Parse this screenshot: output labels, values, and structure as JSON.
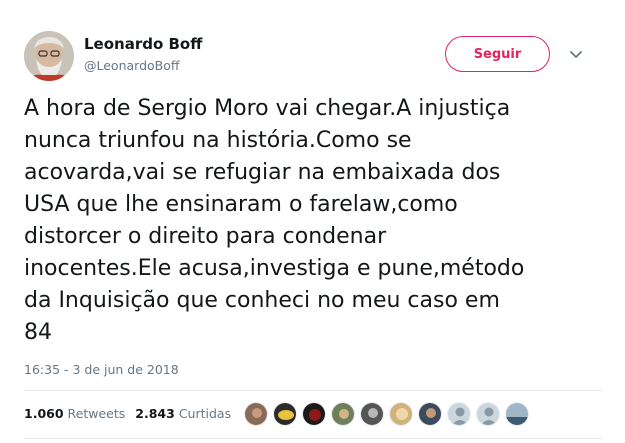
{
  "author": {
    "display_name": "Leonardo Boff",
    "username": "@LeonardoBoff"
  },
  "follow_button": {
    "label": "Seguir"
  },
  "tweet": {
    "text": "A hora de Sergio Moro vai chegar.A injustiça\nnunca triunfou na história.Como se\nacovarda,vai se refugiar na embaixada dos\nUSA que lhe ensinaram o farelaw,como\ndistorcer o direito para condenar\ninocentes.Ele acusa,investiga e pune,método\nda Inquisição que conheci no meu caso em\n84",
    "timestamp": "16:35 - 3 de jun de 2018"
  },
  "stats": {
    "retweets_count": "1.060",
    "retweets_label": "Retweets",
    "likes_count": "2.843",
    "likes_label": "Curtidas"
  },
  "colors": {
    "accent": "#e0245e",
    "secondary_text": "#657786",
    "divider": "#e6ecf0"
  },
  "icons": {
    "caret": "chevron-down-icon"
  }
}
